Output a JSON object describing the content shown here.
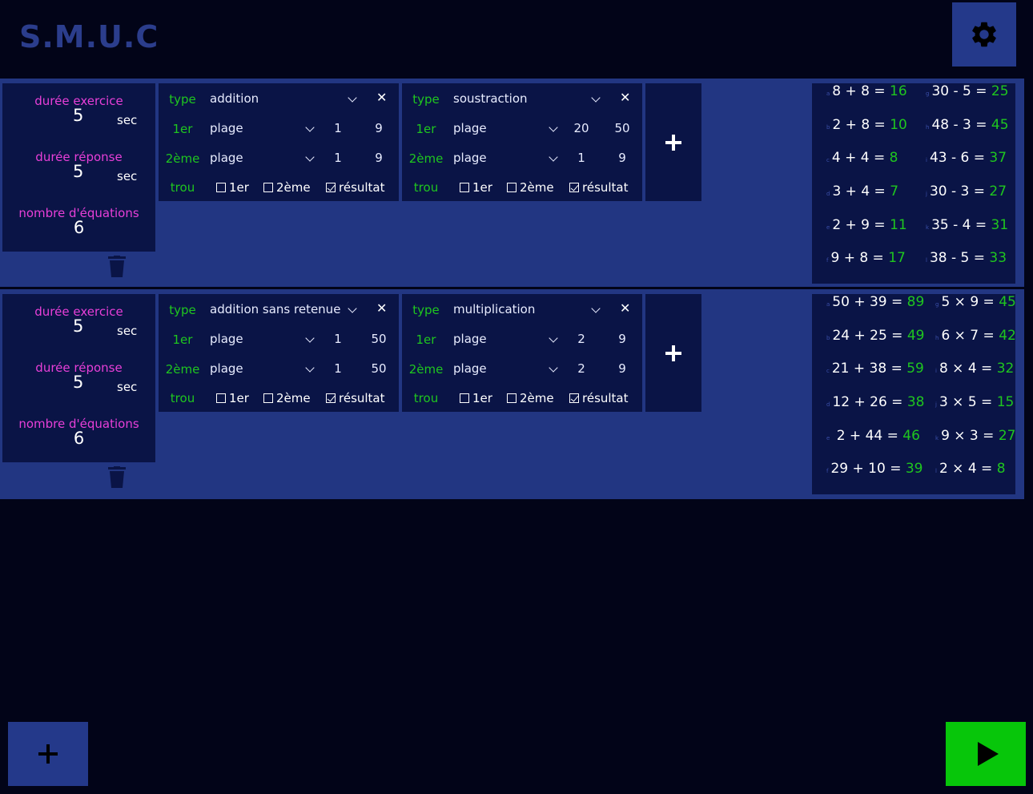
{
  "app": {
    "title": "S.M.U.C"
  },
  "labels": {
    "duree_exercice": "durée exercice",
    "duree_reponse": "durée réponse",
    "nombre_equations": "nombre d'équations",
    "sec": "sec",
    "type": "type",
    "premier": "1er",
    "deuxieme": "2ème",
    "trou": "trou",
    "plage": "plage",
    "resultat": "résultat",
    "close": "✕"
  },
  "icons": {
    "settings": "gear-icon",
    "trash": "trash-icon",
    "add": "plus-icon",
    "play": "play-icon",
    "close": "close-icon",
    "dropdown": "chevron-down-icon"
  },
  "colors": {
    "background": "#020418",
    "panel": "#0a1446",
    "section": "#223682",
    "accent_green": "#1fc61f",
    "accent_pink": "#e83fd8",
    "play_button": "#07c60a"
  },
  "exercises": [
    {
      "duree_exercice": "5",
      "duree_reponse": "5",
      "nombre_equations": "6",
      "equation_types": [
        {
          "type": "addition",
          "first_mode": "plage",
          "first_min": "1",
          "first_max": "9",
          "second_mode": "plage",
          "second_min": "1",
          "second_max": "9",
          "trou_1er": false,
          "trou_2eme": false,
          "trou_resultat": true
        },
        {
          "type": "soustraction",
          "first_mode": "plage",
          "first_min": "20",
          "first_max": "50",
          "second_mode": "plage",
          "second_min": "1",
          "second_max": "9",
          "trou_1er": false,
          "trou_2eme": false,
          "trou_resultat": true
        }
      ],
      "preview": [
        {
          "letter": "a",
          "expr": "8 + 8 =",
          "answer": "16"
        },
        {
          "letter": "b",
          "expr": "2 + 8 =",
          "answer": "10"
        },
        {
          "letter": "c",
          "expr": "4 + 4 =",
          "answer": " 8"
        },
        {
          "letter": "d",
          "expr": "3 + 4 =",
          "answer": " 7"
        },
        {
          "letter": "e",
          "expr": "2 + 9 =",
          "answer": "11"
        },
        {
          "letter": "f",
          "expr": "9 + 8 =",
          "answer": "17"
        },
        {
          "letter": "g",
          "expr": "30 - 5 =",
          "answer": "25"
        },
        {
          "letter": "h",
          "expr": "48 - 3 =",
          "answer": "45"
        },
        {
          "letter": "i",
          "expr": "43 - 6 =",
          "answer": "37"
        },
        {
          "letter": "j",
          "expr": "30 - 3 =",
          "answer": "27"
        },
        {
          "letter": "k",
          "expr": "35 - 4 =",
          "answer": "31"
        },
        {
          "letter": "l",
          "expr": "38 - 5 =",
          "answer": "33"
        }
      ]
    },
    {
      "duree_exercice": "5",
      "duree_reponse": "5",
      "nombre_equations": "6",
      "equation_types": [
        {
          "type": "addition sans retenue",
          "first_mode": "plage",
          "first_min": "1",
          "first_max": "50",
          "second_mode": "plage",
          "second_min": "1",
          "second_max": "50",
          "trou_1er": false,
          "trou_2eme": false,
          "trou_resultat": true
        },
        {
          "type": "multiplication",
          "first_mode": "plage",
          "first_min": "2",
          "first_max": "9",
          "second_mode": "plage",
          "second_min": "2",
          "second_max": "9",
          "trou_1er": false,
          "trou_2eme": false,
          "trou_resultat": true
        }
      ],
      "preview": [
        {
          "letter": "a",
          "expr": "50 + 39 =",
          "answer": "89"
        },
        {
          "letter": "b",
          "expr": "24 + 25 =",
          "answer": "49"
        },
        {
          "letter": "c",
          "expr": "21 + 38 =",
          "answer": "59"
        },
        {
          "letter": "d",
          "expr": "12 + 26 =",
          "answer": "38"
        },
        {
          "letter": "e",
          "expr": " 2  + 44 =",
          "answer": "46"
        },
        {
          "letter": "f",
          "expr": "29 + 10 =",
          "answer": "39"
        },
        {
          "letter": "g",
          "expr": "5 × 9 =",
          "answer": "45"
        },
        {
          "letter": "h",
          "expr": "6 × 7 =",
          "answer": "42"
        },
        {
          "letter": "i",
          "expr": "8 × 4 =",
          "answer": "32"
        },
        {
          "letter": "j",
          "expr": "3 × 5 =",
          "answer": "15"
        },
        {
          "letter": "k",
          "expr": "9 × 3 =",
          "answer": "27"
        },
        {
          "letter": "l",
          "expr": "2 × 4 =",
          "answer": " 8"
        }
      ]
    }
  ]
}
